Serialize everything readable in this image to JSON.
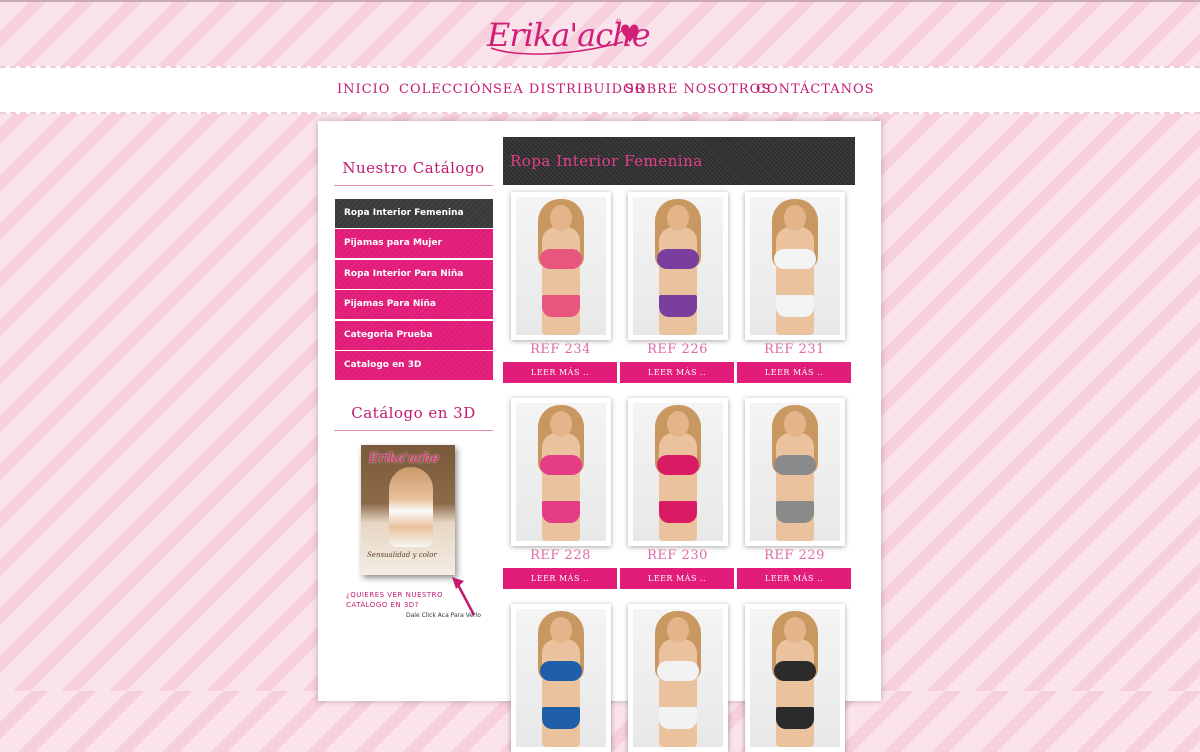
{
  "brand": {
    "logo_text": "Erika'ache",
    "colors": {
      "accent": "#e21c79",
      "dark": "#2e2e2e",
      "text_pink": "#c21a6f",
      "background": "#fbe3ec"
    }
  },
  "nav": {
    "items": [
      {
        "label": "INICIO"
      },
      {
        "label": "COLECCIÓN"
      },
      {
        "label": "SEA DISTRIBUIDOR"
      },
      {
        "label": "SOBRE NOSOTROS"
      },
      {
        "label": "CONTÁCTANOS"
      }
    ]
  },
  "sidebar": {
    "catalog_title": "Nuestro Catálogo",
    "categories": [
      {
        "label": "Ropa Interior Femenina",
        "active": true
      },
      {
        "label": "Pijamas para Mujer"
      },
      {
        "label": "Ropa Interior Para Niña"
      },
      {
        "label": "Pijamas Para Niña"
      },
      {
        "label": "Categoria Prueba"
      },
      {
        "label": "Catalogo en 3D"
      }
    ],
    "catalog3d_title": "Catálogo en 3D",
    "catalog3d": {
      "cover_logo": "Erika'ache",
      "cover_tagline": "Sensualidad y color",
      "cta_line1": "¿QUIERES VER NUESTRO",
      "cta_line2": "CATÁLOGO EN 3D?",
      "cta_small": "Dale Click Aca Para Verlo"
    }
  },
  "main": {
    "category_title": "Ropa Interior Femenina",
    "read_more_label": "LEER MÁS ..",
    "products": [
      {
        "ref": "REF 234",
        "color": "#e8557f"
      },
      {
        "ref": "REF 226",
        "color": "#7a3e9d"
      },
      {
        "ref": "REF 231",
        "color": "#f4f4f4"
      },
      {
        "ref": "REF 228",
        "color": "#e43d86"
      },
      {
        "ref": "REF 230",
        "color": "#d81b63"
      },
      {
        "ref": "REF 229",
        "color": "#8a8a8a"
      },
      {
        "ref": "",
        "color": "#1f5ea8"
      },
      {
        "ref": "",
        "color": "#f2f2f2"
      },
      {
        "ref": "",
        "color": "#2b2b2b"
      }
    ]
  }
}
